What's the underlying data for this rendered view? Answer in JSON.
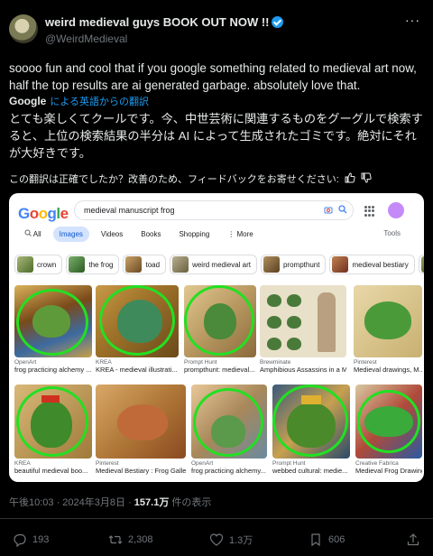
{
  "author": {
    "name": "weird medieval guys BOOK OUT NOW !!",
    "handle": "@WeirdMedieval"
  },
  "more_label": "···",
  "tweet": {
    "text": "soooo fun and cool that if you google something related to medieval art now, half the top results are ai generated garbage. absolutely love that.",
    "translate_provider": "Google",
    "translate_label": "による英語からの翻訳",
    "translation": "とても楽しくてクールです。今、中世芸術に関連するものをグーグルで検索すると、上位の検索結果の半分は AI によって生成されたゴミです。絶対にそれが大好きです。",
    "feedback": "この翻訳は正確でしたか？改善のため、フィードバックをお寄せください:"
  },
  "google": {
    "logo": [
      "G",
      "o",
      "o",
      "g",
      "l",
      "e"
    ],
    "query": "medieval manuscript frog",
    "filters": [
      "All",
      "Images",
      "Videos",
      "Books",
      "Shopping",
      "More"
    ],
    "active_filter": "Images",
    "tools": "Tools",
    "chips": [
      "crown",
      "the frog",
      "toad",
      "weird medieval art",
      "prompthunt",
      "medieval bestiary"
    ],
    "results": [
      {
        "source": "OpenArt",
        "caption": "frog practicing alchemy ...",
        "circled": true
      },
      {
        "source": "KREA",
        "caption": "KREA - medieval illustrati...",
        "circled": true
      },
      {
        "source": "Prompt Hunt",
        "caption": "prompthunt: medieval...",
        "circled": true
      },
      {
        "source": "Brewminate",
        "caption": "Amphibious Assassins in a Me...",
        "circled": false
      },
      {
        "source": "Pinterest",
        "caption": "Medieval drawings, M...",
        "circled": false
      },
      {
        "source": "KREA",
        "caption": "beautiful medieval boo...",
        "circled": true
      },
      {
        "source": "Pinterest",
        "caption": "Medieval Bestiary : Frog Galle...",
        "circled": false
      },
      {
        "source": "OpenArt",
        "caption": "frog practicing alchemy...",
        "circled": true
      },
      {
        "source": "Prompt Hunt",
        "caption": "webbed cultural: medie...",
        "circled": true
      },
      {
        "source": "Creative Fabrica",
        "caption": "Medieval Frog Drawing ...",
        "circled": true
      }
    ]
  },
  "timestamp": {
    "time": "午後10:03 · 2024年3月8日 · ",
    "views": "157.1万",
    "views_label": " 件の表示"
  },
  "actions": {
    "replies": "193",
    "reposts": "2,308",
    "likes": "1.3万",
    "bookmarks": "606"
  },
  "colors": {
    "accent": "#1d9bf0",
    "circle": "#22e022",
    "background": "#000000"
  }
}
